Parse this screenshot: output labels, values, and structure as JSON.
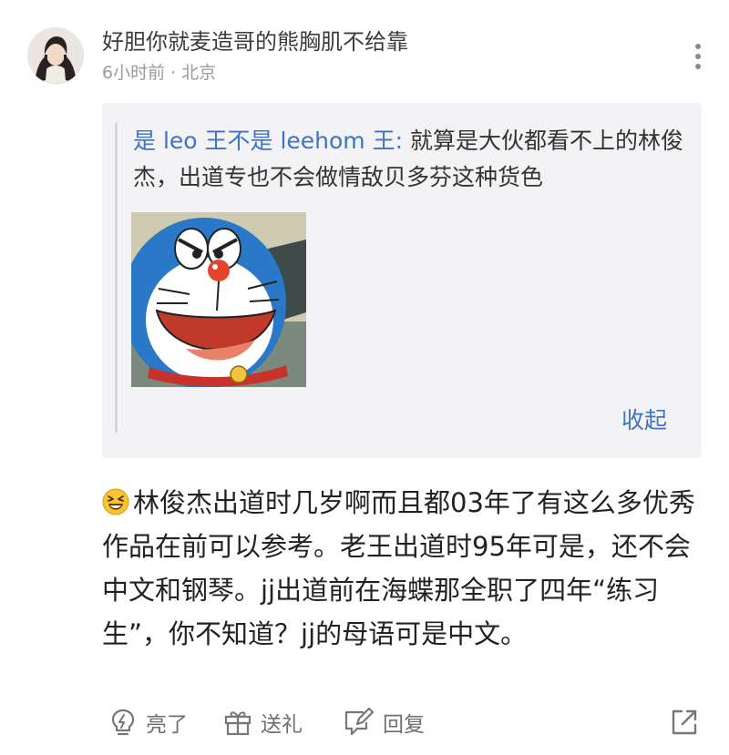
{
  "comment": {
    "username": "好胆你就麦造哥的熊胸肌不给靠",
    "time": "6小时前",
    "separator": "·",
    "location": "北京",
    "quote": {
      "author": "是 leo 王不是 leehom 王:",
      "text": "就算是大伙都看不上的林俊杰，出道专也不会做情敌贝多芬这种货色",
      "collapse_label": "收起",
      "image_icon": "doraemon-sticker"
    },
    "emoji_icon": "grinning-squint-emoji",
    "body": "林俊杰出道时几岁啊而且都03年了有这么多优秀作品在前可以参考。老王出道时95年可是，还不会中文和钢琴。jj出道前在海蝶那全职了四年“练习生”，你不知道？jj的母语可是中文。",
    "actions": {
      "like_label": "亮了",
      "gift_label": "送礼",
      "reply_label": "回复"
    }
  },
  "colors": {
    "link": "#3f74c2",
    "quote_bg": "#f3f3f5",
    "muted": "#9a9a9a"
  }
}
